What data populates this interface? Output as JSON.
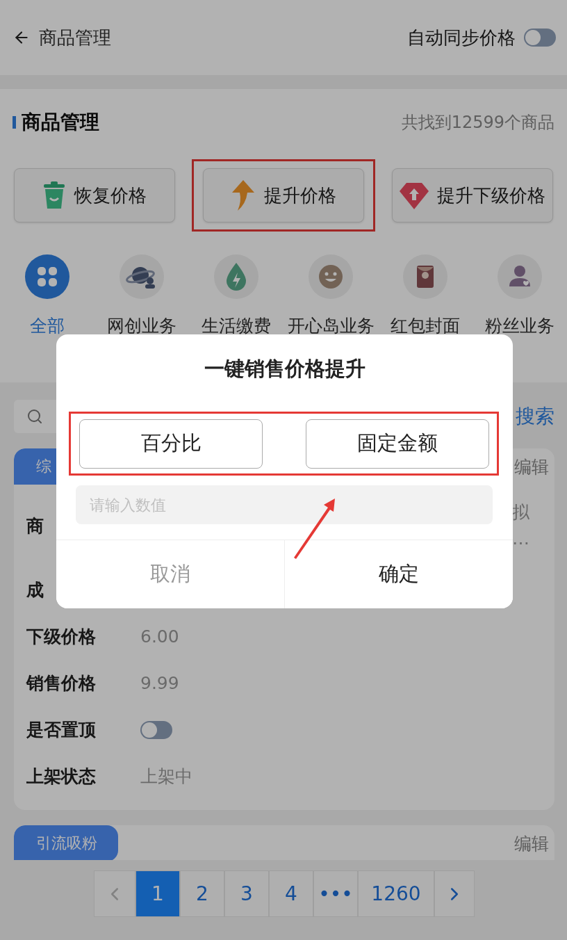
{
  "header": {
    "title": "商品管理",
    "sync_label": "自动同步价格",
    "sync_on": false
  },
  "section": {
    "title": "商品管理",
    "count": "共找到12599个商品"
  },
  "actions": [
    {
      "kind": "restore",
      "label": "恢复价格",
      "highlighted": false
    },
    {
      "kind": "raise",
      "label": "提升价格",
      "highlighted": true
    },
    {
      "kind": "raise_lower",
      "label": "提升下级价格",
      "highlighted": false
    }
  ],
  "categories": [
    {
      "kind": "all",
      "label": "全部",
      "selected": true
    },
    {
      "kind": "planet",
      "label": "网创业务",
      "selected": false
    },
    {
      "kind": "drop",
      "label": "生活缴费",
      "selected": false
    },
    {
      "kind": "smile",
      "label": "开心岛业务",
      "selected": false
    },
    {
      "kind": "envelope",
      "label": "红包封面",
      "selected": false
    },
    {
      "kind": "person",
      "label": "粉丝业务",
      "selected": false
    }
  ],
  "search": {
    "button": "搜索"
  },
  "cards": [
    {
      "tab": "综",
      "edit": "编辑",
      "rows": [
        {
          "kind": "tail",
          "label": "商",
          "lines": [
            "拟",
            "…"
          ]
        },
        {
          "kind": "text",
          "label": "成"
        },
        {
          "kind": "text",
          "label": "下级价格",
          "value": "6.00"
        },
        {
          "kind": "text",
          "label": "销售价格",
          "value": "9.99"
        },
        {
          "kind": "toggle",
          "label": "是否置顶",
          "on": false
        },
        {
          "kind": "text",
          "label": "上架状态",
          "value": "上架中"
        }
      ]
    },
    {
      "tab": "引流吸粉",
      "edit": "编辑"
    }
  ],
  "pagination": {
    "pages": [
      {
        "label": "1",
        "selected": true
      },
      {
        "label": "2",
        "selected": false
      },
      {
        "label": "3",
        "selected": false
      },
      {
        "label": "4",
        "selected": false
      },
      {
        "label": "•••",
        "selected": false
      },
      {
        "label": "1260",
        "selected": false
      }
    ]
  },
  "dialog": {
    "title": "一键销售价格提升",
    "options": [
      "百分比",
      "固定金额"
    ],
    "options_highlighted": true,
    "placeholder": "请输入数值",
    "cancel": "取消",
    "confirm": "确定"
  }
}
